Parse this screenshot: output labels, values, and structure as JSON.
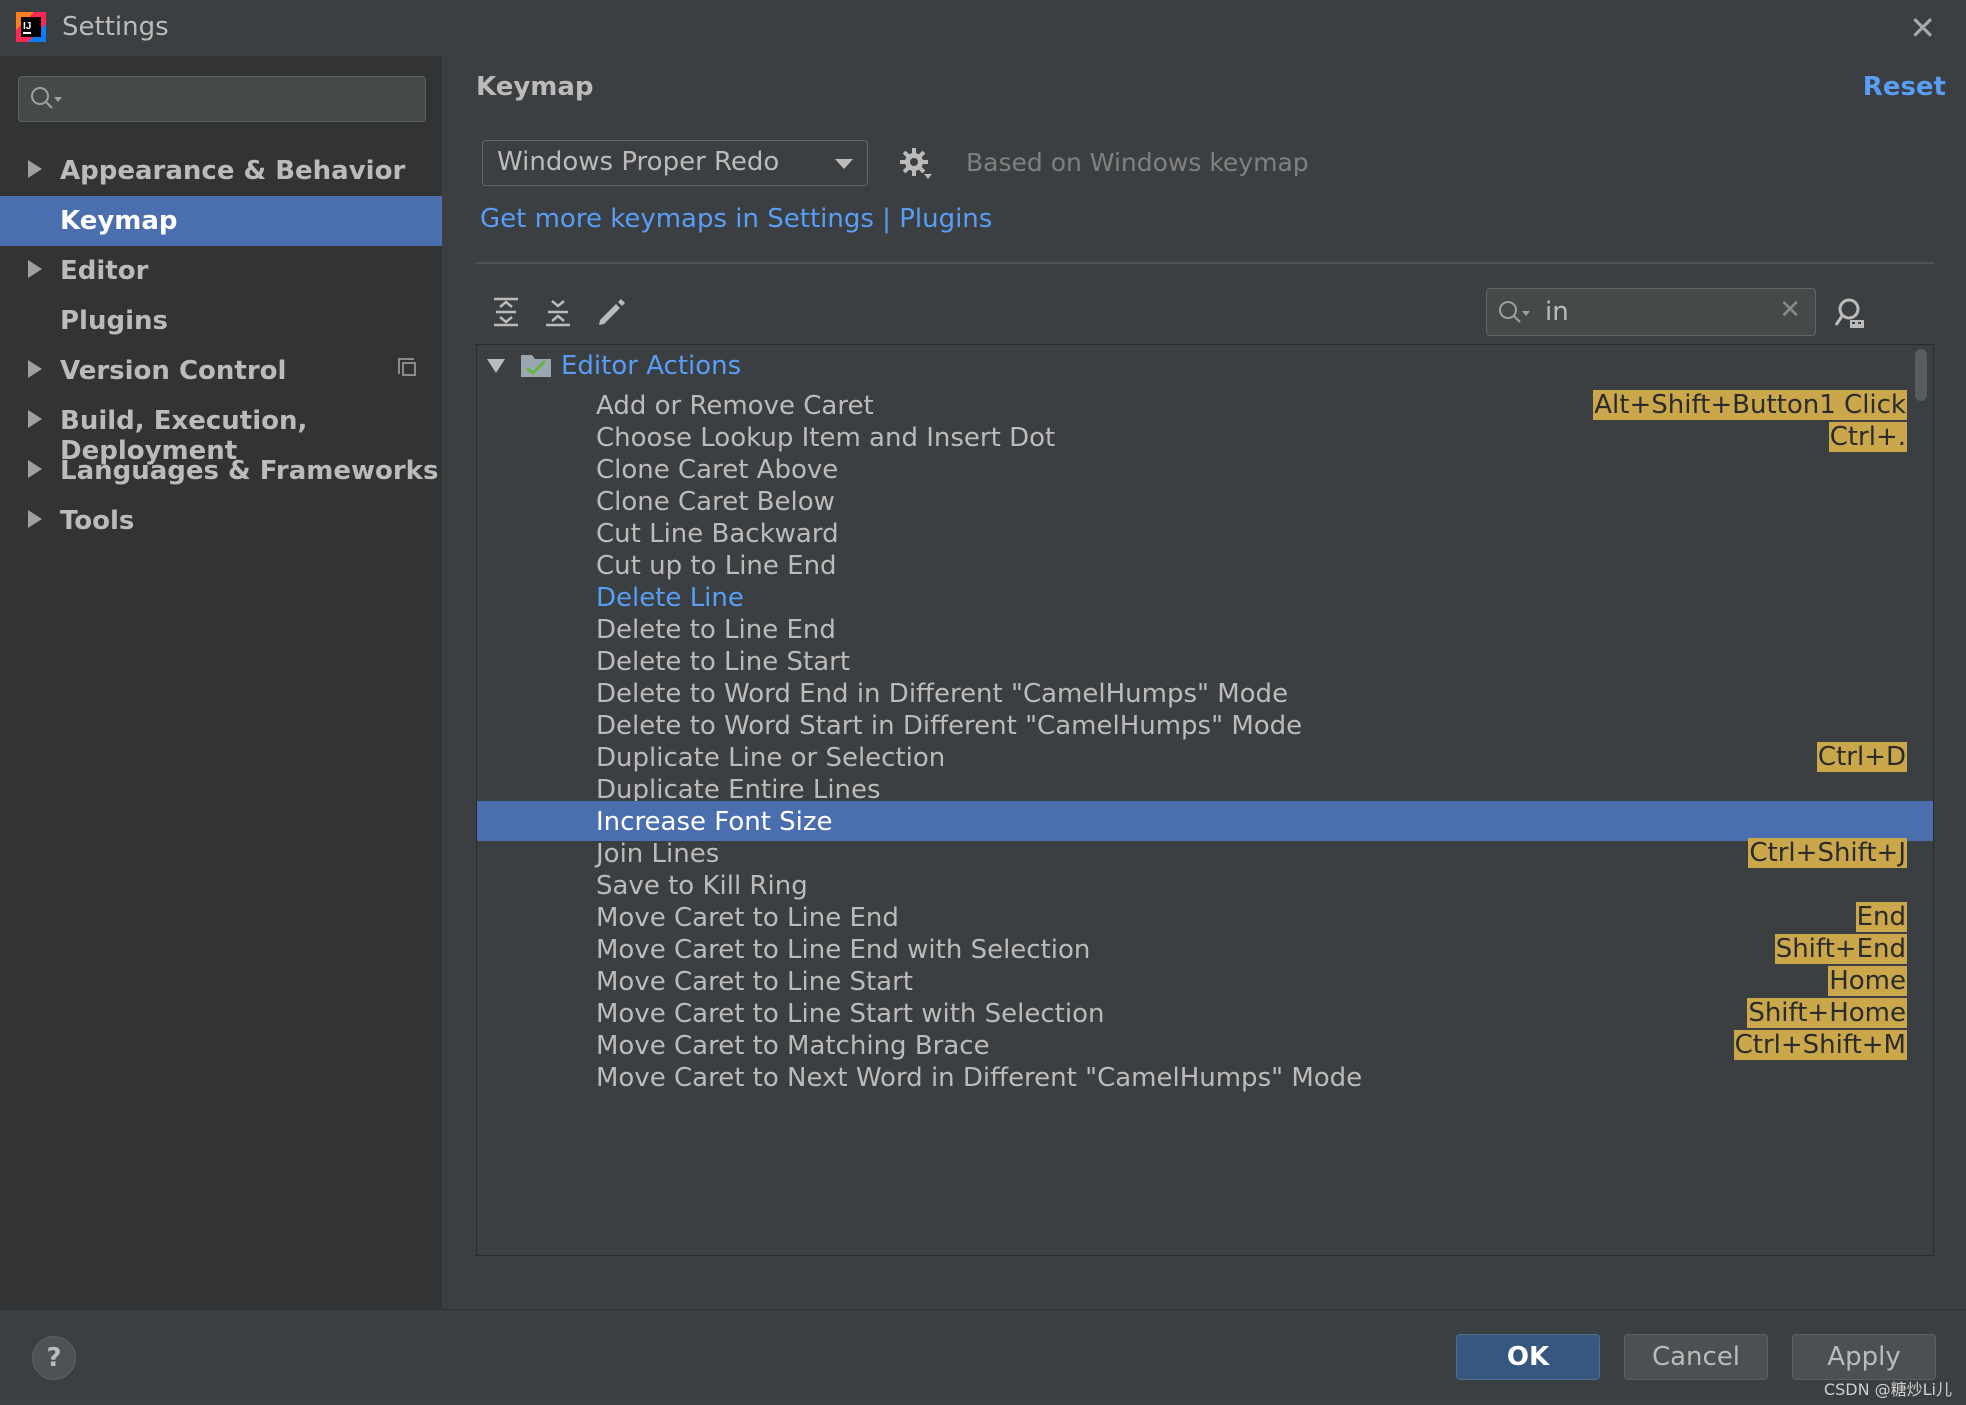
{
  "window": {
    "title": "Settings"
  },
  "sidebar": {
    "search_value": "",
    "items": [
      {
        "label": "Appearance & Behavior",
        "expandable": true,
        "selected": false
      },
      {
        "label": "Keymap",
        "expandable": false,
        "selected": true
      },
      {
        "label": "Editor",
        "expandable": true,
        "selected": false
      },
      {
        "label": "Plugins",
        "expandable": false,
        "selected": false
      },
      {
        "label": "Version Control",
        "expandable": true,
        "selected": false
      },
      {
        "label": "Build, Execution, Deployment",
        "expandable": true,
        "selected": false
      },
      {
        "label": "Languages & Frameworks",
        "expandable": true,
        "selected": false
      },
      {
        "label": "Tools",
        "expandable": true,
        "selected": false
      }
    ]
  },
  "main": {
    "title": "Keymap",
    "reset_label": "Reset",
    "keymap_value": "Windows Proper Redo",
    "based_on": "Based on Windows keymap",
    "more_link": "Get more keymaps in Settings | Plugins",
    "filter_value": "in"
  },
  "tree": {
    "group_label": "Editor Actions",
    "rows": [
      {
        "name": "Add or Remove Caret",
        "shortcut": "Alt+Shift+Button1 Click"
      },
      {
        "name": "Choose Lookup Item and Insert Dot",
        "shortcut": "Ctrl+."
      },
      {
        "name": "Clone Caret Above",
        "shortcut": ""
      },
      {
        "name": "Clone Caret Below",
        "shortcut": ""
      },
      {
        "name": "Cut Line Backward",
        "shortcut": ""
      },
      {
        "name": "Cut up to Line End",
        "shortcut": ""
      },
      {
        "name": "Delete Line",
        "shortcut": "",
        "style": "blue"
      },
      {
        "name": "Delete to Line End",
        "shortcut": ""
      },
      {
        "name": "Delete to Line Start",
        "shortcut": ""
      },
      {
        "name": "Delete to Word End in Different \"CamelHumps\" Mode",
        "shortcut": ""
      },
      {
        "name": "Delete to Word Start in Different \"CamelHumps\" Mode",
        "shortcut": ""
      },
      {
        "name": "Duplicate Line or Selection",
        "shortcut": "Ctrl+D"
      },
      {
        "name": "Duplicate Entire Lines",
        "shortcut": ""
      },
      {
        "name": "Increase Font Size",
        "shortcut": "",
        "style": "selected"
      },
      {
        "name": "Join Lines",
        "shortcut": "Ctrl+Shift+J"
      },
      {
        "name": "Save to Kill Ring",
        "shortcut": ""
      },
      {
        "name": "Move Caret to Line End",
        "shortcut": "End"
      },
      {
        "name": "Move Caret to Line End with Selection",
        "shortcut": "Shift+End"
      },
      {
        "name": "Move Caret to Line Start",
        "shortcut": "Home"
      },
      {
        "name": "Move Caret to Line Start with Selection",
        "shortcut": "Shift+Home"
      },
      {
        "name": "Move Caret to Matching Brace",
        "shortcut": "Ctrl+Shift+M"
      },
      {
        "name": "Move Caret to Next Word in Different \"CamelHumps\" Mode",
        "shortcut": ""
      }
    ]
  },
  "buttons": {
    "ok": "OK",
    "cancel": "Cancel",
    "apply": "Apply",
    "help": "?"
  },
  "watermark": "CSDN @糖炒Li儿",
  "colors": {
    "accent": "#4b6eaf",
    "link": "#589df6",
    "highlight": "#c9a74a",
    "background": "#3c3f41",
    "sidebar": "#313335"
  }
}
